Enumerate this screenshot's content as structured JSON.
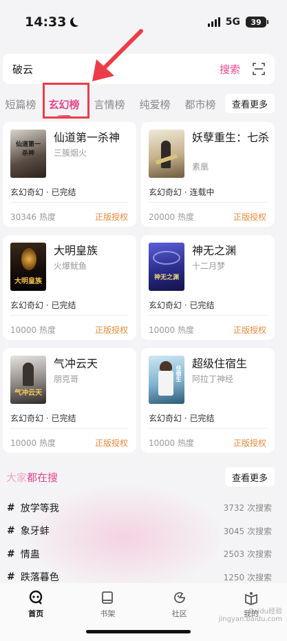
{
  "status": {
    "time": "14:33",
    "network": "5G",
    "battery": "39"
  },
  "search": {
    "query": "破云",
    "button": "搜索"
  },
  "tabs": [
    "短篇榜",
    "玄幻榜",
    "言情榜",
    "纯爱榜",
    "都市榜"
  ],
  "tabs_more": "查看更多",
  "books": [
    {
      "title": "仙道第一杀神",
      "author": "三簇烟火",
      "tag": "玄幻奇幻 · 已完结",
      "heat": "30346 热度",
      "license": "正版授权",
      "cover_text": "仙道第一杀神"
    },
    {
      "title": "妖孽重生：七杀",
      "author": "素凰",
      "tag": "玄幻奇幻 · 连载中",
      "heat": "20000 热度",
      "license": "正版授权",
      "cover_text": ""
    },
    {
      "title": "大明皇族",
      "author": "火爆鱿鱼",
      "tag": "玄幻奇幻 · 已完结",
      "heat": "10000 热度",
      "license": "正版授权",
      "cover_text": "大明皇族"
    },
    {
      "title": "神无之渊",
      "author": "十二月梦",
      "tag": "玄幻奇幻 · 已完结",
      "heat": "10000 热度",
      "license": "正版授权",
      "cover_text": "神无之渊"
    },
    {
      "title": "气冲云天",
      "author": "朋克哥",
      "tag": "玄幻奇幻 · 已完结",
      "heat": "10000 热度",
      "license": "正版授权",
      "cover_text": "气冲云天"
    },
    {
      "title": "超级住宿生",
      "author": "阿拉丁神经",
      "tag": "玄幻奇幻 · 已完结",
      "heat": "10000 热度",
      "license": "正版授权",
      "cover_text": "住宿生"
    }
  ],
  "hot_section": {
    "title_a": "大家",
    "title_b": "都在搜",
    "more": "查看更多"
  },
  "hot_searches": [
    {
      "term": "放学等我",
      "count": "3732 次搜索"
    },
    {
      "term": "象牙蚌",
      "count": "3045 次搜索"
    },
    {
      "term": "情蛊",
      "count": "2503 次搜索"
    },
    {
      "term": "跌落暮色",
      "count": "1250 次搜索"
    }
  ],
  "nav": [
    "首页",
    "书架",
    "社区",
    "我的"
  ],
  "watermark": "Baidu经验 jingyan.baidu.com",
  "colors": {
    "accent": "#e8458b",
    "license": "#e98a3a",
    "annotation": "#ee3b48"
  }
}
